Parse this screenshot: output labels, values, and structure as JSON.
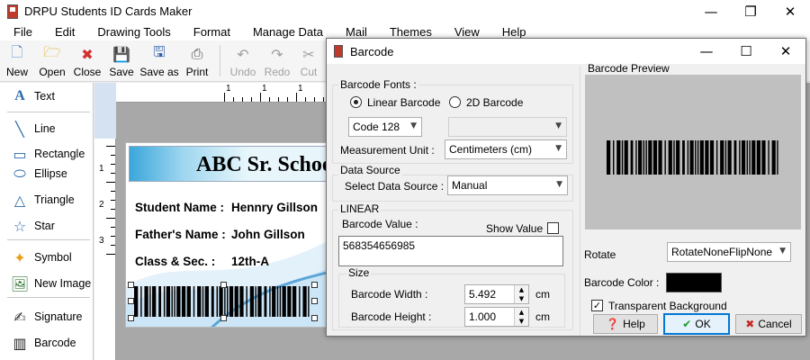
{
  "app": {
    "title": "DRPU Students ID Cards Maker",
    "controls": {
      "minimize": "—",
      "restore": "❐",
      "close": "✕"
    }
  },
  "menu": [
    "File",
    "Edit",
    "Drawing Tools",
    "Format",
    "Manage Data",
    "Mail",
    "Themes",
    "View",
    "Help"
  ],
  "toolbar": {
    "new": "New",
    "open": "Open",
    "close": "Close",
    "save": "Save",
    "save_as": "Save as",
    "print": "Print",
    "undo": "Undo",
    "redo": "Redo",
    "cut": "Cut",
    "copy": "Co"
  },
  "left_tools": {
    "text": "Text",
    "line": "Line",
    "rectangle": "Rectangle",
    "ellipse": "Ellipse",
    "triangle": "Triangle",
    "star": "Star",
    "symbol": "Symbol",
    "new_image": "New Image",
    "signature": "Signature",
    "barcode": "Barcode"
  },
  "rulers": {
    "top": [
      "1",
      "1",
      "1"
    ],
    "left": [
      "1",
      "2",
      "3"
    ]
  },
  "card": {
    "title": "ABC Sr. Schoo",
    "rows": [
      {
        "label": "Student Name :",
        "value": "Hennry Gillson"
      },
      {
        "label": "Father's Name :",
        "value": "John Gillson"
      },
      {
        "label": "Class & Sec. :",
        "value": "12th-A"
      }
    ],
    "accent_color": "#3aa7da"
  },
  "dialog": {
    "title": "Barcode",
    "controls": {
      "minimize": "—",
      "maximize": "☐",
      "close": "✕"
    },
    "barcode_fonts_label": "Barcode Fonts :",
    "linear_label": "Linear Barcode",
    "twod_label": "2D Barcode",
    "symbology": "Code 128",
    "unit_label": "Measurement Unit :",
    "unit_value": "Centimeters (cm)",
    "data_source_group": "Data Source",
    "data_source_label": "Select Data Source :",
    "data_source_value": "Manual",
    "linear_group": "LINEAR",
    "barcode_value_label": "Barcode Value :",
    "show_value_label": "Show Value",
    "barcode_value": "568354656985",
    "size_group": "Size",
    "width_label": "Barcode Width :",
    "width_value": "5.492",
    "width_unit": "cm",
    "height_label": "Barcode Height :",
    "height_value": "1.000",
    "height_unit": "cm",
    "preview_label": "Barcode Preview",
    "rotate_label": "Rotate",
    "rotate_value": "RotateNoneFlipNone",
    "color_label": "Barcode Color :",
    "barcode_color": "#000000",
    "transparent_label": "Transparent Background",
    "help_btn": "Help",
    "ok_btn": "OK",
    "cancel_btn": "Cancel"
  }
}
